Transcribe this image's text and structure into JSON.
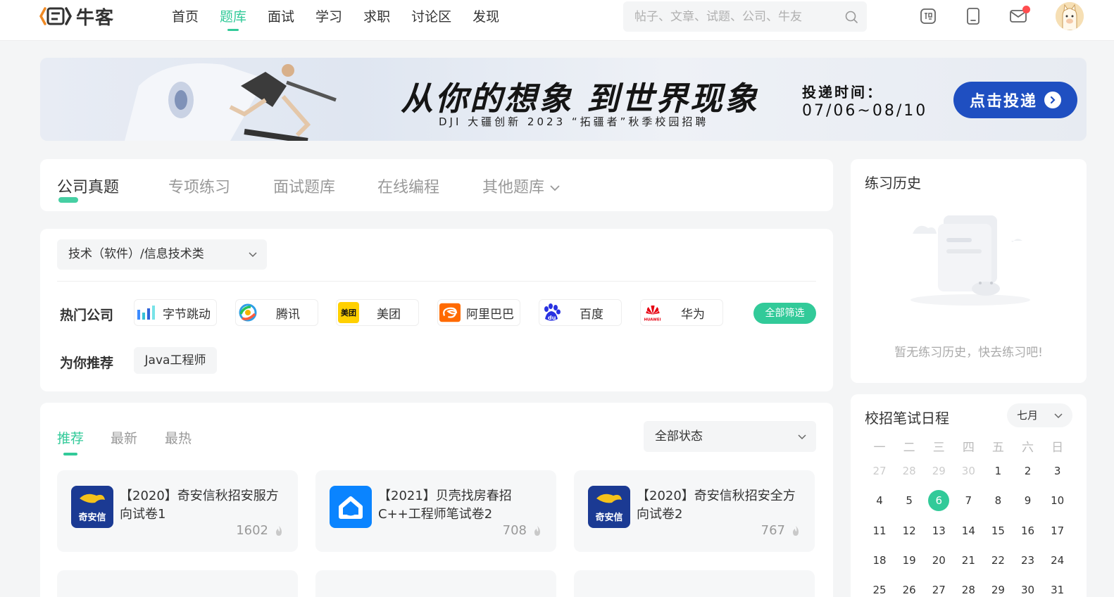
{
  "brand": {
    "name": "牛客",
    "accent": "#32ca99"
  },
  "nav": [
    {
      "label": "首页",
      "active": false
    },
    {
      "label": "题库",
      "active": true
    },
    {
      "label": "面试",
      "active": false
    },
    {
      "label": "学习",
      "active": false
    },
    {
      "label": "求职",
      "active": false
    },
    {
      "label": "讨论区",
      "active": false
    },
    {
      "label": "发现",
      "active": false
    }
  ],
  "search": {
    "placeholder": "帖子、文章、试题、公司、牛友"
  },
  "toolbar_icons": [
    "recruit-icon",
    "tablet-icon",
    "mail-icon"
  ],
  "banner": {
    "slogan": "从你的想象 到世界现象",
    "subtitle": "DJI 大疆创新 2023 “拓疆者”秋季校园招聘",
    "time_label": "投递时间：",
    "time_range": "07/06~08/10",
    "button": "点击投递"
  },
  "main_tabs": [
    {
      "label": "公司真题",
      "active": true
    },
    {
      "label": "专项练习",
      "active": false
    },
    {
      "label": "面试题库",
      "active": false
    },
    {
      "label": "在线编程",
      "active": false
    },
    {
      "label": "其他题库",
      "active": false
    }
  ],
  "filter": {
    "category": "技术（软件）/信息技术类",
    "hot_label": "热门公司",
    "companies": [
      {
        "name": "字节跳动",
        "logo": "bytedance-logo"
      },
      {
        "name": "腾讯",
        "logo": "tencent-logo"
      },
      {
        "name": "美团",
        "logo": "meituan-logo",
        "logo_text": "美团"
      },
      {
        "name": "阿里巴巴",
        "logo": "alibaba-logo"
      },
      {
        "name": "百度",
        "logo": "baidu-logo",
        "logo_text": "du"
      },
      {
        "name": "华为",
        "logo": "huawei-logo",
        "logo_text": "HUAWEI"
      }
    ],
    "all_filter": "全部筛选",
    "recommend_label": "为你推荐",
    "recommend_tag": "Java工程师"
  },
  "list": {
    "tabs": [
      {
        "label": "推荐",
        "active": true
      },
      {
        "label": "最新",
        "active": false
      },
      {
        "label": "最热",
        "active": false
      }
    ],
    "status": "全部状态",
    "papers": [
      {
        "title": "【2020】奇安信秋招安服方向试卷1",
        "heat": "1602",
        "logo": "qianxin-logo",
        "logo_text": "奇安信"
      },
      {
        "title": "【2021】贝壳找房春招C++工程师笔试卷2",
        "heat": "708",
        "logo": "beike-logo"
      },
      {
        "title": "【2020】奇安信秋招安全方向试卷2",
        "heat": "767",
        "logo": "qianxin-logo",
        "logo_text": "奇安信"
      }
    ]
  },
  "history": {
    "title": "练习历史",
    "empty": "暂无练习历史，快去练习吧!"
  },
  "calendar": {
    "title": "校招笔试日程",
    "month": "七月",
    "weekdays": [
      "一",
      "二",
      "三",
      "四",
      "五",
      "六",
      "日"
    ],
    "days": [
      {
        "d": "27",
        "muted": true
      },
      {
        "d": "28",
        "muted": true
      },
      {
        "d": "29",
        "muted": true
      },
      {
        "d": "30",
        "muted": true
      },
      {
        "d": "1"
      },
      {
        "d": "2"
      },
      {
        "d": "3"
      },
      {
        "d": "4"
      },
      {
        "d": "5"
      },
      {
        "d": "6",
        "today": true
      },
      {
        "d": "7"
      },
      {
        "d": "8"
      },
      {
        "d": "9"
      },
      {
        "d": "10"
      },
      {
        "d": "11"
      },
      {
        "d": "12"
      },
      {
        "d": "13"
      },
      {
        "d": "14"
      },
      {
        "d": "15"
      },
      {
        "d": "16"
      },
      {
        "d": "17"
      },
      {
        "d": "18"
      },
      {
        "d": "19"
      },
      {
        "d": "20"
      },
      {
        "d": "21"
      },
      {
        "d": "22"
      },
      {
        "d": "23"
      },
      {
        "d": "24"
      },
      {
        "d": "25"
      },
      {
        "d": "26"
      },
      {
        "d": "27"
      },
      {
        "d": "28"
      },
      {
        "d": "29"
      },
      {
        "d": "30"
      },
      {
        "d": "31"
      }
    ]
  }
}
